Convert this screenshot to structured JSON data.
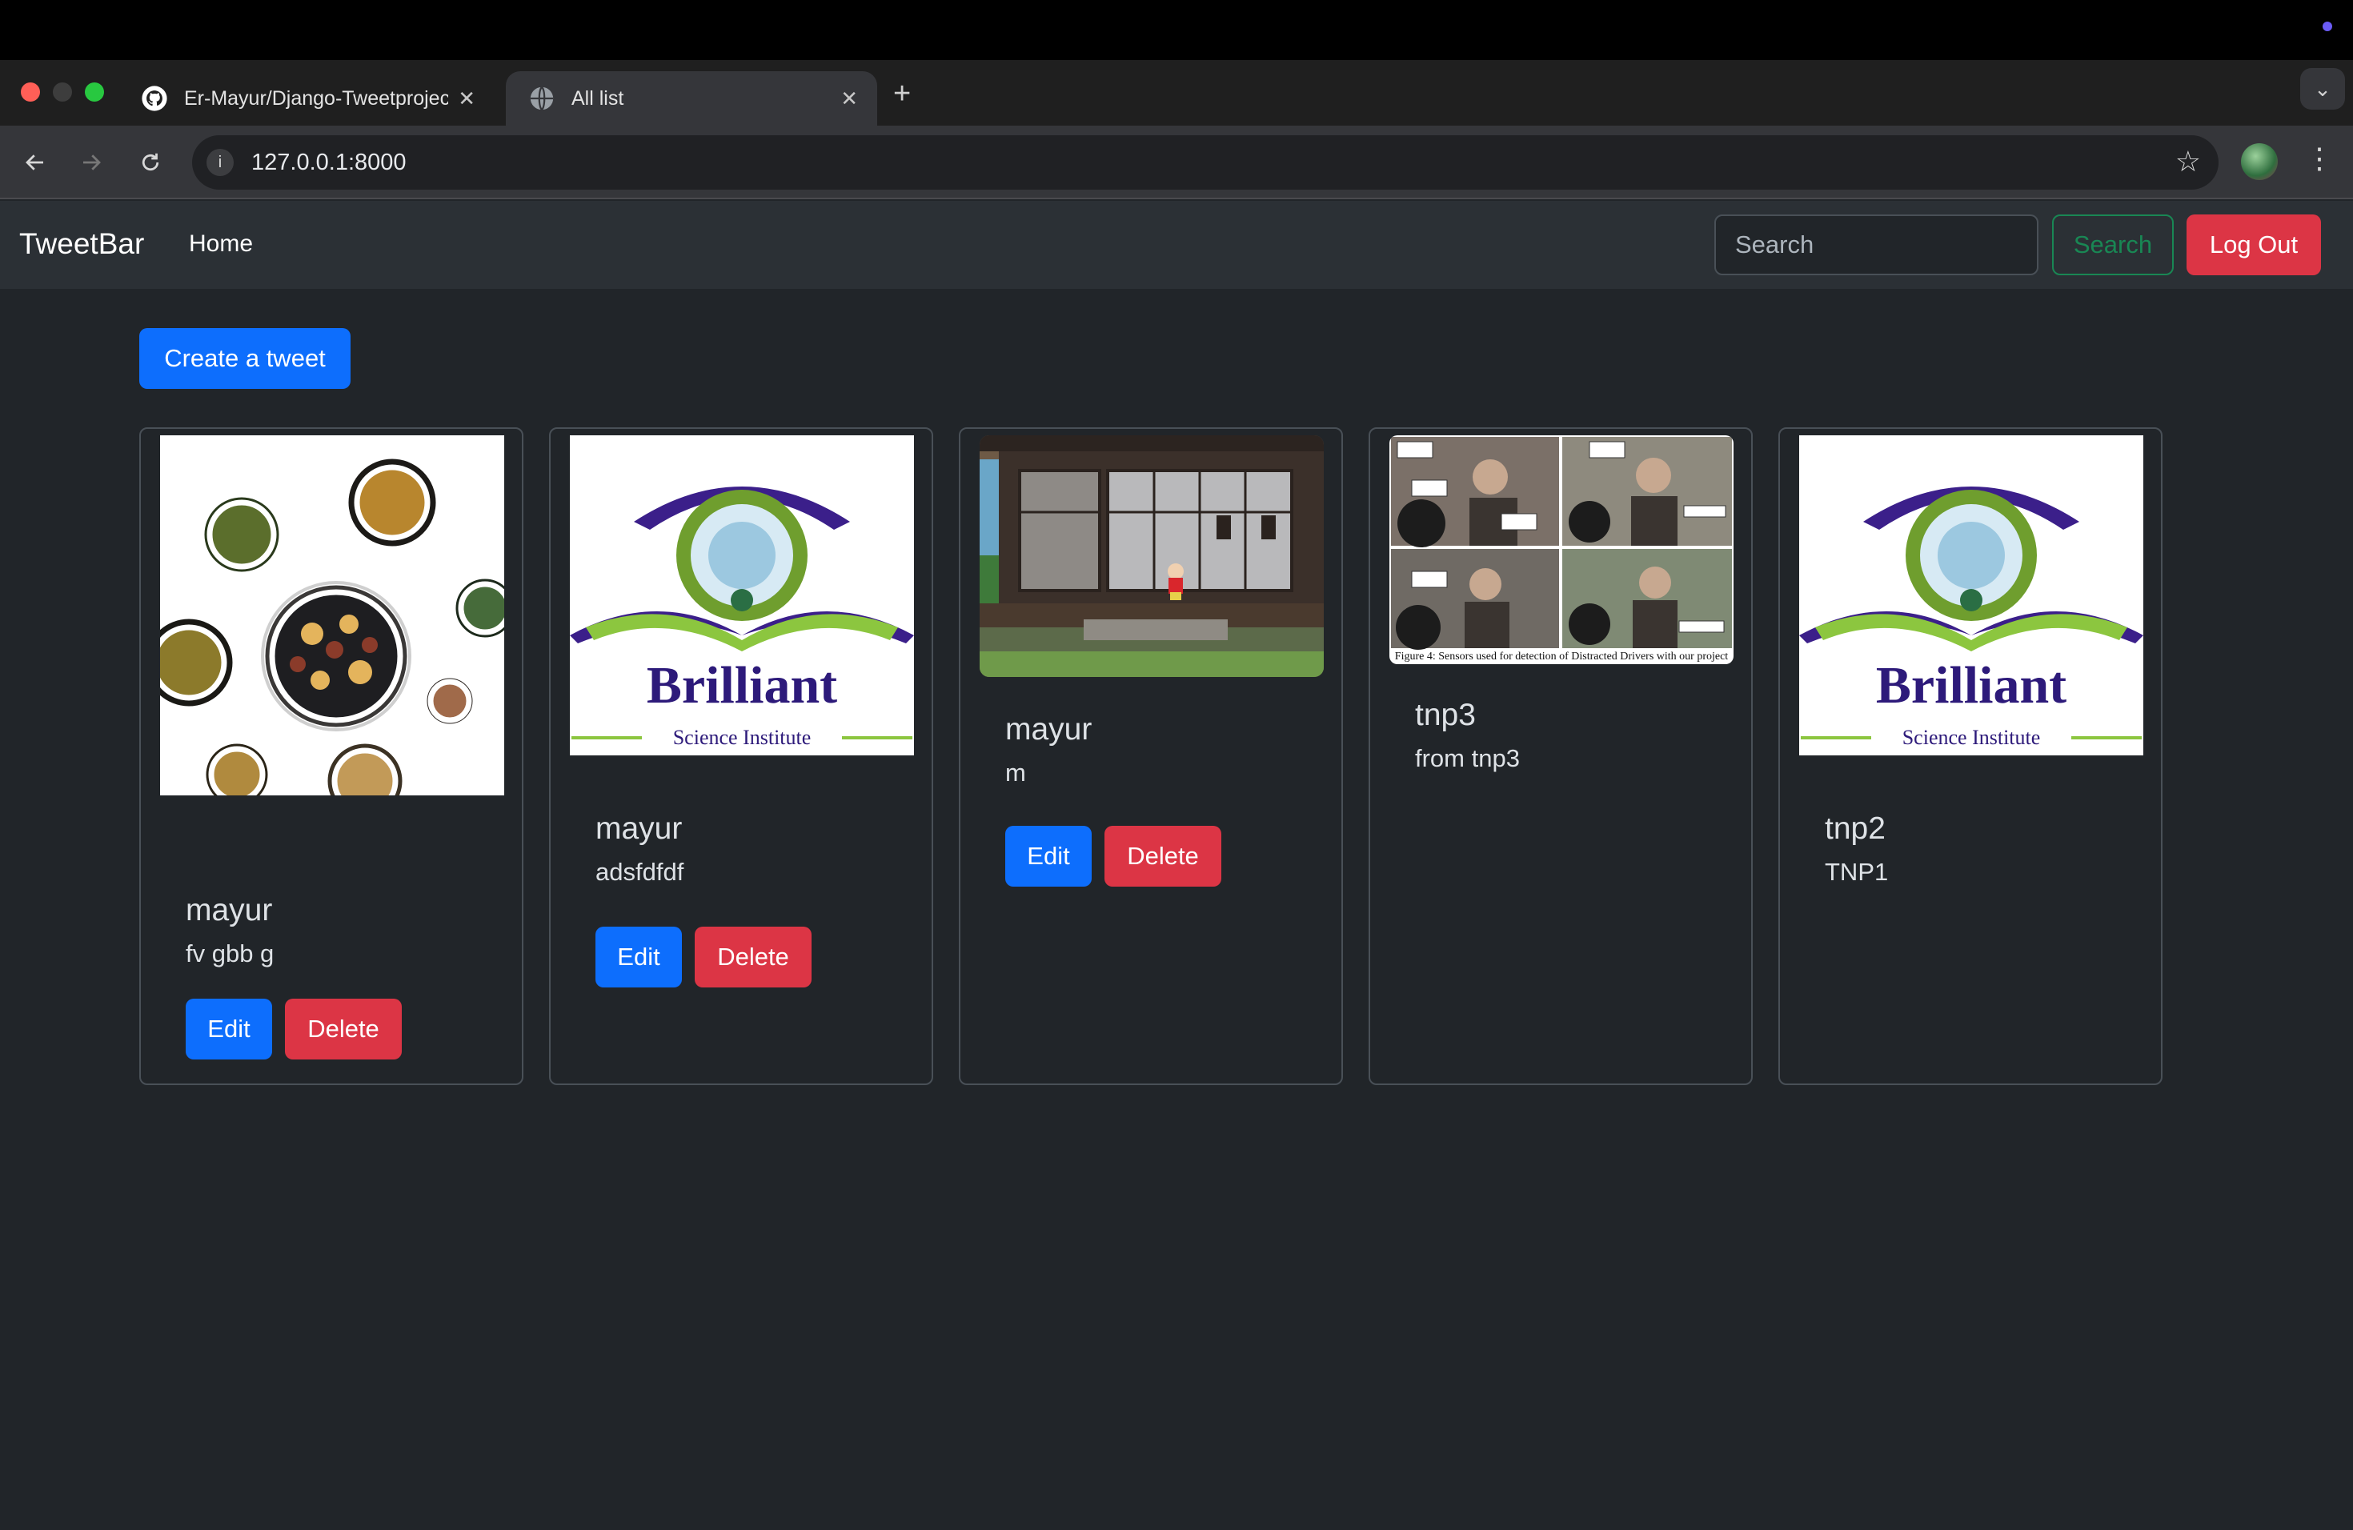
{
  "browser": {
    "tabs": [
      {
        "title": "Er-Mayur/Django-Tweetproject",
        "favicon": "github-icon"
      },
      {
        "title": "All list",
        "favicon": "globe-icon"
      }
    ],
    "url": "127.0.0.1:8000"
  },
  "navbar": {
    "brand": "TweetBar",
    "home": "Home",
    "search_placeholder": "Search",
    "search_button": "Search",
    "logout_button": "Log Out"
  },
  "main": {
    "create_button": "Create a tweet",
    "tweets": [
      {
        "user": "mayur",
        "text": "fv gbb g",
        "image": "food-collage-image",
        "edit": "Edit",
        "delete": "Delete"
      },
      {
        "user": "mayur",
        "text": "adsfdfdf",
        "image": "brilliant-logo-image",
        "logo_title": "Brilliant",
        "logo_subtitle": "Science Institute",
        "edit": "Edit",
        "delete": "Delete"
      },
      {
        "user": "mayur",
        "text": "m",
        "image": "cartoon-house-image",
        "edit": "Edit",
        "delete": "Delete"
      },
      {
        "user": "tnp3",
        "text": "from tnp3",
        "image": "driver-sensors-figure",
        "figure_caption": "Figure 4: Sensors used for detection of Distracted Drivers with our project"
      },
      {
        "user": "tnp2",
        "text": "TNP1",
        "image": "brilliant-logo-image",
        "logo_title": "Brilliant",
        "logo_subtitle": "Science Institute"
      }
    ]
  },
  "colors": {
    "primary": "#0d6efd",
    "danger": "#dc3545",
    "success": "#198754",
    "background": "#212529"
  }
}
